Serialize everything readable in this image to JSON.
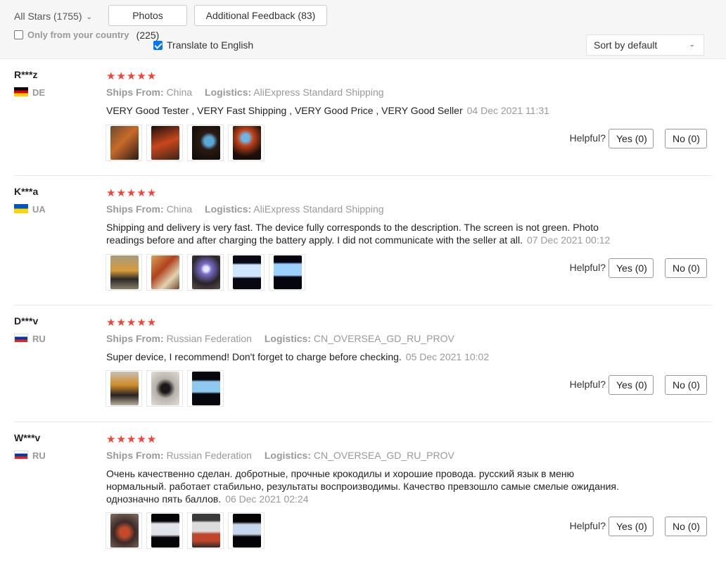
{
  "filters": {
    "stars_label": "All Stars (1755)",
    "photos_label": "Photos (225)",
    "feedback_label": "Additional Feedback (83)",
    "only_country_label": "Only from your country",
    "only_country_checked": false,
    "translate_label": "Translate to English",
    "translate_checked": true,
    "sort_label": "Sort by default"
  },
  "reviews": [
    {
      "user": "R***z",
      "country": "DE",
      "flag": "de",
      "stars": "★★★★★",
      "ships_from_label": "Ships From:",
      "ships_from": "China",
      "logistics_label": "Logistics:",
      "logistics": "AliExpress Standard Shipping",
      "text": "VERY Good Tester , VERY Fast Shipping , VERY Good Price , VERY Good Seller",
      "date": "04 Dec 2021 11:31",
      "helpful_label": "Helpful?",
      "yes_label": "Yes (0)",
      "no_label": "No (0)"
    },
    {
      "user": "K***a",
      "country": "UA",
      "flag": "ua",
      "stars": "★★★★★",
      "ships_from_label": "Ships From:",
      "ships_from": "China",
      "logistics_label": "Logistics:",
      "logistics": "AliExpress Standard Shipping",
      "text": "Shipping and delivery is very fast. The device fully corresponds to the description. The screen is not green. Photo readings before and after charging the battery apply. I did not communicate with the seller at all.",
      "date": "07 Dec 2021 00:12",
      "helpful_label": "Helpful?",
      "yes_label": "Yes (0)",
      "no_label": "No (0)"
    },
    {
      "user": "D***v",
      "country": "RU",
      "flag": "ru",
      "stars": "★★★★★",
      "ships_from_label": "Ships From:",
      "ships_from": "Russian Federation",
      "logistics_label": "Logistics:",
      "logistics": "CN_OVERSEA_GD_RU_PROV",
      "text": "Super device, I recommend! Don't forget to charge before checking.",
      "date": "05 Dec 2021 10:02",
      "helpful_label": "Helpful?",
      "yes_label": "Yes (0)",
      "no_label": "No (0)"
    },
    {
      "user": "W***v",
      "country": "RU",
      "flag": "ru",
      "stars": "★★★★★",
      "ships_from_label": "Ships From:",
      "ships_from": "Russian Federation",
      "logistics_label": "Logistics:",
      "logistics": "CN_OVERSEA_GD_RU_PROV",
      "text": "Очень качественно сделан. добротные, прочные крокодилы и хорошие провода. русский язык в меню нормальный. работает стабильно, результаты воспроизводимы. Качество превзошло самые смелые ожидания. однозначно пять баллов.",
      "date": "06 Dec 2021 02:24",
      "helpful_label": "Helpful?",
      "yes_label": "Yes (0)",
      "no_label": "No (0)"
    }
  ],
  "colors": {
    "star": "#f44336",
    "muted": "#999999",
    "checkbox_on": "#0075ff"
  }
}
